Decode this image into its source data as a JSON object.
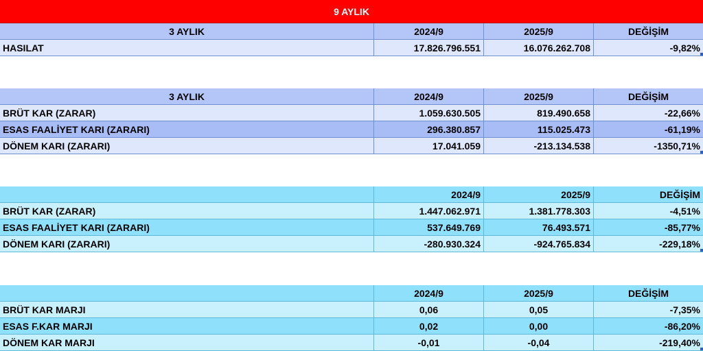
{
  "title": "9 AYLIK",
  "block1": {
    "header": [
      "3 AYLIK",
      "2024/9",
      "2025/9",
      "DEĞİŞİM"
    ],
    "rows": [
      [
        "HASILAT",
        "17.826.796.551",
        "16.076.262.708",
        "-9,82%"
      ]
    ]
  },
  "block2": {
    "header": [
      "3 AYLIK",
      "2024/9",
      "2025/9",
      "DEĞİŞİM"
    ],
    "rows": [
      [
        "BRÜT KAR (ZARAR)",
        "1.059.630.505",
        "819.490.658",
        "-22,66%"
      ],
      [
        "ESAS FAALİYET KARI (ZARARI)",
        "296.380.857",
        "115.025.473",
        "-61,19%"
      ],
      [
        "DÖNEM KARI (ZARARI)",
        "17.041.059",
        "-213.134.538",
        "-1350,71%"
      ]
    ]
  },
  "block3": {
    "header": [
      "",
      "2024/9",
      "2025/9",
      "DEĞİŞİM"
    ],
    "rows": [
      [
        "BRÜT KAR (ZARAR)",
        "1.447.062.971",
        "1.381.778.303",
        "-4,51%"
      ],
      [
        "ESAS FAALİYET KARI (ZARARI)",
        "537.649.769",
        "76.493.571",
        "-85,77%"
      ],
      [
        "DÖNEM KARI (ZARARI)",
        "-280.930.324",
        "-924.765.834",
        "-229,18%"
      ]
    ]
  },
  "block4": {
    "header": [
      "",
      "2024/9",
      "2025/9",
      "DEĞİŞİM"
    ],
    "rows": [
      [
        "BRÜT KAR MARJI",
        "0,06",
        "0,05",
        "-7,35%"
      ],
      [
        "ESAS F.KAR MARJI",
        "0,02",
        "0,00",
        "-86,20%"
      ],
      [
        "DÖNEM KAR MARJI",
        "-0,01",
        "-0,04",
        "-219,40%"
      ]
    ]
  },
  "colors": {
    "title_bg": "#ff0000",
    "blue_header": "#b4c6f8",
    "blue_row": "#dfe7fd",
    "cyan_header": "#8fe0fb",
    "cyan_row": "#c9f0fd"
  }
}
